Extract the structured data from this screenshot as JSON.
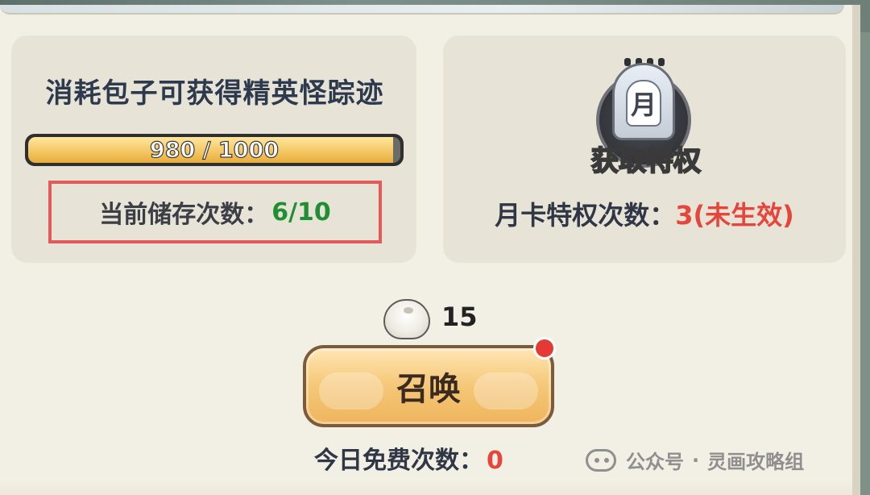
{
  "header": {
    "title": "消耗包子可获得精英怪踪迹"
  },
  "progress": {
    "text": "980 / 1000",
    "value": 980,
    "max": 1000,
    "fraction": 0.98
  },
  "storage": {
    "label": "当前储存次数：",
    "value": "6/10"
  },
  "privilege": {
    "medal_char": "月",
    "get_privilege_label": "获取特权",
    "monthly_label": "月卡特权次数：",
    "monthly_value": "3(未生效)"
  },
  "bun": {
    "icon": "bun-icon",
    "count": "15"
  },
  "summon": {
    "label": "召唤",
    "notification_dot": true
  },
  "free": {
    "label": "今日免费次数：",
    "value": "0"
  },
  "watermark": {
    "icon": "wechat-icon",
    "text": "公众号",
    "separator": "·",
    "author": "灵画攻略组"
  },
  "colors": {
    "panel_bg": "#f2efe4",
    "card_bg": "#e7e3d7",
    "accent_green": "#1f8f32",
    "accent_red": "#e5453b",
    "button_gold": "#f5c777"
  }
}
